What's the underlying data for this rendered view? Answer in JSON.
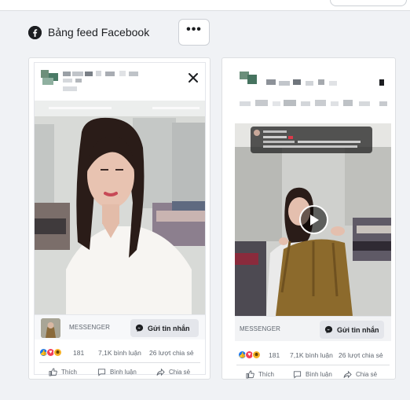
{
  "header": {
    "icon": "facebook-icon",
    "title": "Bảng feed Facebook",
    "more_label": "•••"
  },
  "ads": [
    {
      "media_type": "photo",
      "messenger_label": "MESSENGER",
      "cta_label": "Gửi tin nhắn",
      "reaction_count": "181",
      "comments": "7,1K bình luận",
      "shares": "26 lượt chia sẻ",
      "actions": {
        "like": "Thích",
        "comment": "Bình luận",
        "share": "Chia sẻ"
      }
    },
    {
      "media_type": "video",
      "messenger_label": "MESSENGER",
      "cta_label": "Gửi tin nhắn",
      "reaction_count": "181",
      "comments": "7,1K bình luận",
      "shares": "26 lượt chia sẻ",
      "actions": {
        "like": "Thích",
        "comment": "Bình luận",
        "share": "Chia sẻ"
      }
    }
  ],
  "colors": {
    "page_bg": "#f0f2f5",
    "like_blue": "#1877f2",
    "love_red": "#f33e58",
    "haha_yellow": "#f7b125",
    "button_grey": "#e4e6eb",
    "secondary_text": "#606770"
  }
}
